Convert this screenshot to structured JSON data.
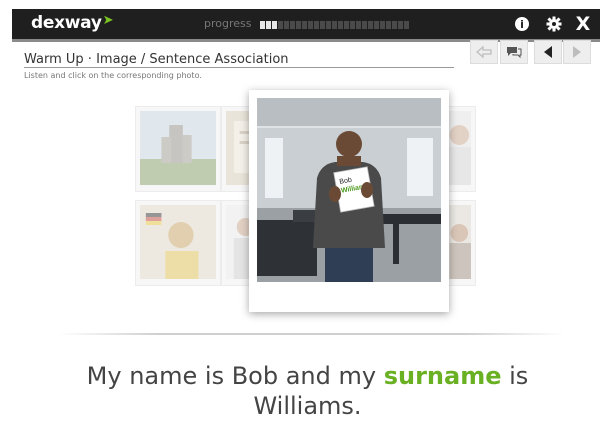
{
  "app": {
    "logo_text": "dexway",
    "progress_label": "progress",
    "progress": {
      "completed_segments": 3,
      "total_segments": 25
    }
  },
  "top_buttons": {
    "info_icon": "info-icon",
    "settings_icon": "gear-icon",
    "close_icon": "close-icon",
    "info_glyph": "i",
    "close_glyph": "X"
  },
  "header": {
    "title": "Warm Up · Image / Sentence Association",
    "instruction": "Listen and click on the corresponding photo."
  },
  "controls": [
    "back-arrow-icon",
    "speech-bubble-icon",
    "prev-icon",
    "next-icon"
  ],
  "photo_card": {
    "sign_line1": "Bob",
    "sign_line2": "Williams"
  },
  "sentence": {
    "before": "My name is Bob and my ",
    "keyword": "surname",
    "after": " is Williams."
  },
  "colors": {
    "topbar": "#1f1f1f",
    "keyword_green": "#6ab023",
    "logo_arrow": "#7bc520"
  }
}
